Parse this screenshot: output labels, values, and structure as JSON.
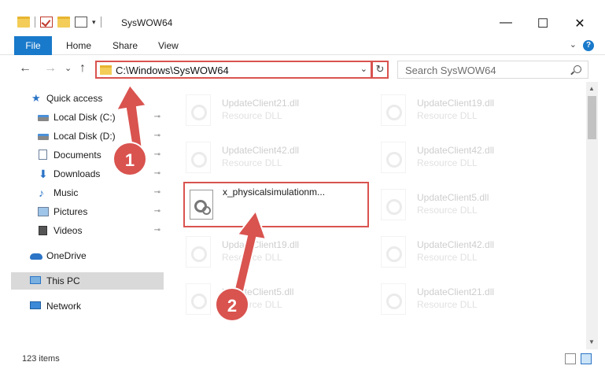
{
  "window": {
    "title": "SysWOW64",
    "minimize": "—",
    "maximize": "☐",
    "close": "✕"
  },
  "ribbon": {
    "file_tab": "File",
    "tabs": [
      "Home",
      "Share",
      "View"
    ],
    "help": "?"
  },
  "nav": {
    "back": "←",
    "forward": "→",
    "recent": "⌄",
    "up": "↑",
    "address": "C:\\Windows\\SysWOW64",
    "refresh": "↻",
    "search_placeholder": "Search SysWOW64"
  },
  "sidebar": {
    "items": [
      {
        "label": "Quick access",
        "icon": "star-icon",
        "pinned": false
      },
      {
        "label": "Local Disk (C:)",
        "icon": "disk-icon",
        "pinned": true
      },
      {
        "label": "Local Disk (D:)",
        "icon": "disk-icon",
        "pinned": true
      },
      {
        "label": "Documents",
        "icon": "documents-icon",
        "pinned": true
      },
      {
        "label": "Downloads",
        "icon": "downloads-icon",
        "pinned": true
      },
      {
        "label": "Music",
        "icon": "music-icon",
        "pinned": true
      },
      {
        "label": "Pictures",
        "icon": "pictures-icon",
        "pinned": true
      },
      {
        "label": "Videos",
        "icon": "videos-icon",
        "pinned": true
      },
      {
        "label": "OneDrive",
        "icon": "onedrive-icon",
        "pinned": false
      },
      {
        "label": "This PC",
        "icon": "pc-icon",
        "pinned": false,
        "selected": true
      },
      {
        "label": "Network",
        "icon": "network-icon",
        "pinned": false
      }
    ],
    "pin_glyph": "📌"
  },
  "files": {
    "left_column": [
      {
        "name": "UpdateClient21.dll",
        "type": "Resource DLL"
      },
      {
        "name": "UpdateClient42.dll",
        "type": "Resource DLL"
      },
      {
        "name": "UpdateClient19.dll",
        "type": "Resource DLL"
      },
      {
        "name": "UpdateClient5.dll",
        "type": "Resource DLL"
      }
    ],
    "right_column": [
      {
        "name": "UpdateClient19.dll",
        "type": "Resource DLL"
      },
      {
        "name": "UpdateClient42.dll",
        "type": "Resource DLL"
      },
      {
        "name": "UpdateClient5.dll",
        "type": "Resource DLL"
      },
      {
        "name": "UpdateClient42.dll",
        "type": "Resource DLL"
      },
      {
        "name": "UpdateClient21.dll",
        "type": "Resource DLL"
      }
    ],
    "highlighted": {
      "name": "x_physicalsimulationm..."
    }
  },
  "status": {
    "item_count": "123 items"
  },
  "annotations": {
    "step1": "1",
    "step2": "2",
    "color": "#d9534f"
  }
}
